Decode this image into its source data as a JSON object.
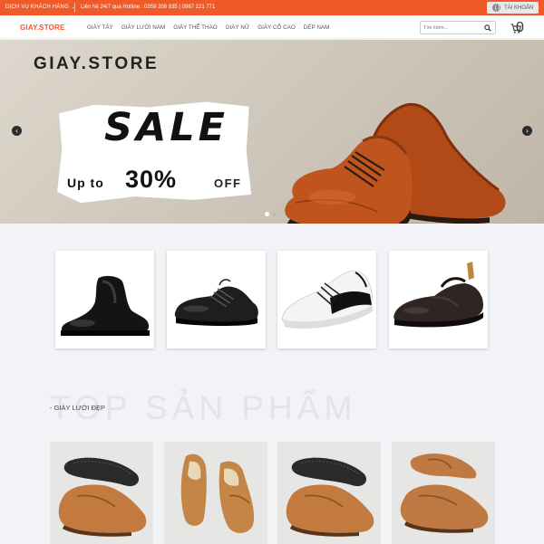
{
  "topbar": {
    "service_label": "DỊCH VỤ KHÁCH HÀNG",
    "hotline_text": "Liên hệ 24/7 qua Hotline : 0359 208 835 | 0987 221 771",
    "account_label": "TÀI KHOẢN"
  },
  "header": {
    "logo_text": "GIAY.STORE",
    "nav": [
      "GIÀY TÂY",
      "GIÀY LƯỜI NAM",
      "GIÀY THỂ THAO",
      "GIÀY NỮ",
      "GIÀY CỔ CAO",
      "DÉP NAM"
    ],
    "search_placeholder": "Tìm kiếm...",
    "cart_count": "0"
  },
  "banner": {
    "brand": "GIAY.STORE",
    "sale": "SALE",
    "upto": "Up to",
    "percent": "30%",
    "off": "OFF",
    "slides": 2,
    "active_slide": 1
  },
  "categories": [
    {
      "icon": "chelsea-boot-icon",
      "color": "#141414"
    },
    {
      "icon": "oxford-shoe-icon",
      "color": "#1e1e1e"
    },
    {
      "icon": "sneaker-icon",
      "color": "#f4f4f4"
    },
    {
      "icon": "loafer-icon",
      "color": "#2f2624"
    }
  ],
  "top_products": {
    "watermark": "TOP SẢN PHẨM",
    "subheading": "- GIÀY LƯỜI ĐẸP",
    "items": [
      {
        "icon": "loafer-pair-icon",
        "color": "#c27a3e"
      },
      {
        "icon": "loafer-pair-icon",
        "color": "#c48646"
      },
      {
        "icon": "loafer-pair-icon",
        "color": "#c27a3e"
      },
      {
        "icon": "loafer-pair-icon",
        "color": "#bf7a44"
      }
    ]
  },
  "colors": {
    "accent": "#f05a28",
    "banner_shoe": "#c0541f"
  }
}
